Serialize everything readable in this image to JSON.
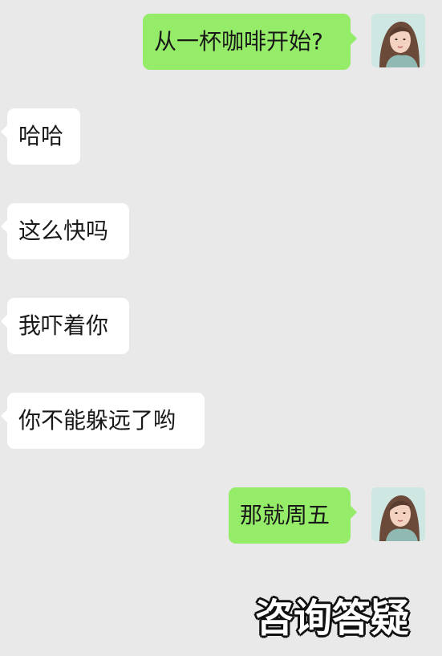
{
  "messages": [
    {
      "from": "me",
      "text": "从一杯咖啡开始?"
    },
    {
      "from": "other",
      "text": "哈哈"
    },
    {
      "from": "other",
      "text": "这么快吗"
    },
    {
      "from": "other",
      "text": "我吓着你"
    },
    {
      "from": "other",
      "text": "你不能躲远了哟"
    },
    {
      "from": "me",
      "text": "那就周五"
    }
  ],
  "watermark": "咨询答疑",
  "avatar_icon": "woman-portrait-icon",
  "colors": {
    "background": "#e9e9e9",
    "bubble_out": "#95ec69",
    "bubble_in": "#ffffff"
  }
}
